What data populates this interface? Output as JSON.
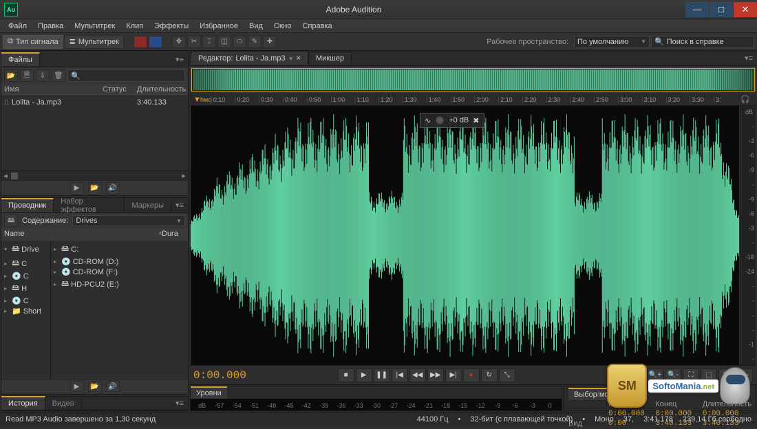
{
  "titlebar": {
    "app_badge": "Au",
    "title": "Adobe Audition"
  },
  "menu": [
    "Файл",
    "Правка",
    "Мультитрек",
    "Клип",
    "Эффекты",
    "Избранное",
    "Вид",
    "Окно",
    "Справка"
  ],
  "modebar": {
    "signal": "Тип сигнала",
    "multitrack": "Мультитрек",
    "workspace_label": "Рабочее пространство:",
    "workspace_value": "По умолчанию",
    "search_placeholder": "Поиск в справке"
  },
  "files_panel": {
    "tab": "Файлы",
    "cols": {
      "name": "Имя",
      "status": "Статус",
      "duration": "Длительность"
    },
    "items": [
      {
        "name": "Lolita - Ja.mp3",
        "duration": "3:40.133"
      }
    ]
  },
  "transport_icons": {
    "play": "▶",
    "open": "📂",
    "speaker": "🔊"
  },
  "browser_panel": {
    "tabs": [
      "Проводник",
      "Набор эффектов",
      "Маркеры"
    ],
    "content_label": "Содержание:",
    "content_value": "Drives",
    "tree": [
      "Drive",
      "C",
      "C",
      "H",
      "C",
      "Short"
    ],
    "drive_cols": {
      "name": "Name",
      "dur": "Dura"
    },
    "drives": [
      "C:",
      "CD-ROM (D:)",
      "CD-ROM (F:)",
      "HD-PCU2 (E:)"
    ]
  },
  "history_panel": {
    "tabs": [
      "История",
      "Видео"
    ]
  },
  "editor": {
    "tab_prefix": "Редактор:",
    "filename": "Lolita - Ja.mp3",
    "mixer_tab": "Микшер",
    "ruler_start": "hмс",
    "ticks": [
      "0:10",
      "0:20",
      "0:30",
      "0:40",
      "0:50",
      "1:00",
      "1:10",
      "1:20",
      "1:30",
      "1:40",
      "1:50",
      "2:00",
      "2:10",
      "2:20",
      "2:30",
      "2:40",
      "2:50",
      "3:00",
      "3:10",
      "3:20",
      "3:30",
      "3:"
    ],
    "db_hdr": "dB",
    "db_scale_top": [
      "-",
      "-3",
      "-6",
      "-9",
      "-",
      "-9",
      "-6",
      "-3",
      "-"
    ],
    "db_scale_bot": [
      "-18",
      "-24",
      "-",
      "-",
      "-",
      "-",
      "-1",
      "-"
    ],
    "hud_gain": "+0 dB",
    "timecode": "0:00.000"
  },
  "levels": {
    "tab": "Уровни",
    "marks": [
      "dB",
      "-57",
      "-54",
      "-51",
      "-48",
      "-45",
      "-42",
      "-39",
      "-36",
      "-33",
      "-30",
      "-27",
      "-24",
      "-21",
      "-18",
      "-15",
      "-12",
      "-9",
      "-6",
      "-3",
      "0"
    ]
  },
  "selection": {
    "tab": "Выбор",
    "tab2": "мое",
    "cols": {
      "start": "Начало",
      "end": "Конец",
      "dur": "Длительность"
    },
    "rows": [
      {
        "label": "",
        "start": "0:00.000",
        "end": "0:00.000",
        "dur": "0:00.000"
      },
      {
        "label": "Вид",
        "start": "0:00",
        "end": "3:40.133",
        "dur": "3:40.133"
      }
    ]
  },
  "status": {
    "msg": "Read MP3 Audio завершено за 1,30 секунд",
    "sr": "44100 Гц",
    "bits": "32-бит (с плавающей точкой)",
    "ch": "Моно",
    "sz": "37,",
    "dur": "3:41.178",
    "free": "239,14 Гб свободно"
  }
}
